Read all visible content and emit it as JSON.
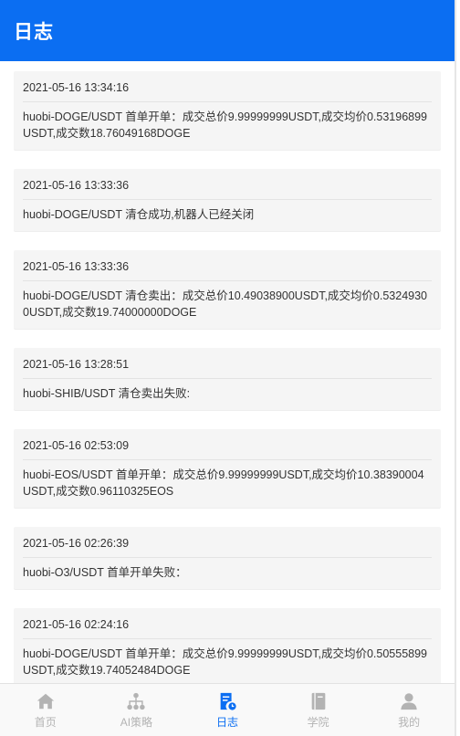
{
  "header": {
    "title": "日志"
  },
  "logs": [
    {
      "time": "2021-05-16 13:34:16",
      "message": "huobi-DOGE/USDT 首单开单：成交总价9.99999999USDT,成交均价0.53196899USDT,成交数18.76049168DOGE"
    },
    {
      "time": "2021-05-16 13:33:36",
      "message": "huobi-DOGE/USDT 清仓成功,机器人已经关闭"
    },
    {
      "time": "2021-05-16 13:33:36",
      "message": "huobi-DOGE/USDT 清仓卖出：成交总价10.49038900USDT,成交均价0.53249300USDT,成交数19.74000000DOGE"
    },
    {
      "time": "2021-05-16 13:28:51",
      "message": "huobi-SHIB/USDT 清仓卖出失败:"
    },
    {
      "time": "2021-05-16 02:53:09",
      "message": "huobi-EOS/USDT 首单开单：成交总价9.99999999USDT,成交均价10.38390004USDT,成交数0.96110325EOS"
    },
    {
      "time": "2021-05-16 02:26:39",
      "message": "huobi-O3/USDT 首单开单失败："
    },
    {
      "time": "2021-05-16 02:24:16",
      "message": "huobi-DOGE/USDT 首单开单：成交总价9.99999999USDT,成交均价0.50555899USDT,成交数19.74052484DOGE"
    }
  ],
  "tabbar": {
    "home": "首页",
    "strategy": "AI策略",
    "log": "日志",
    "academy": "学院",
    "mine": "我的"
  },
  "colors": {
    "primary": "#0b6ef2",
    "inactive": "#b3b3b3",
    "card": "#f5f5f5"
  }
}
